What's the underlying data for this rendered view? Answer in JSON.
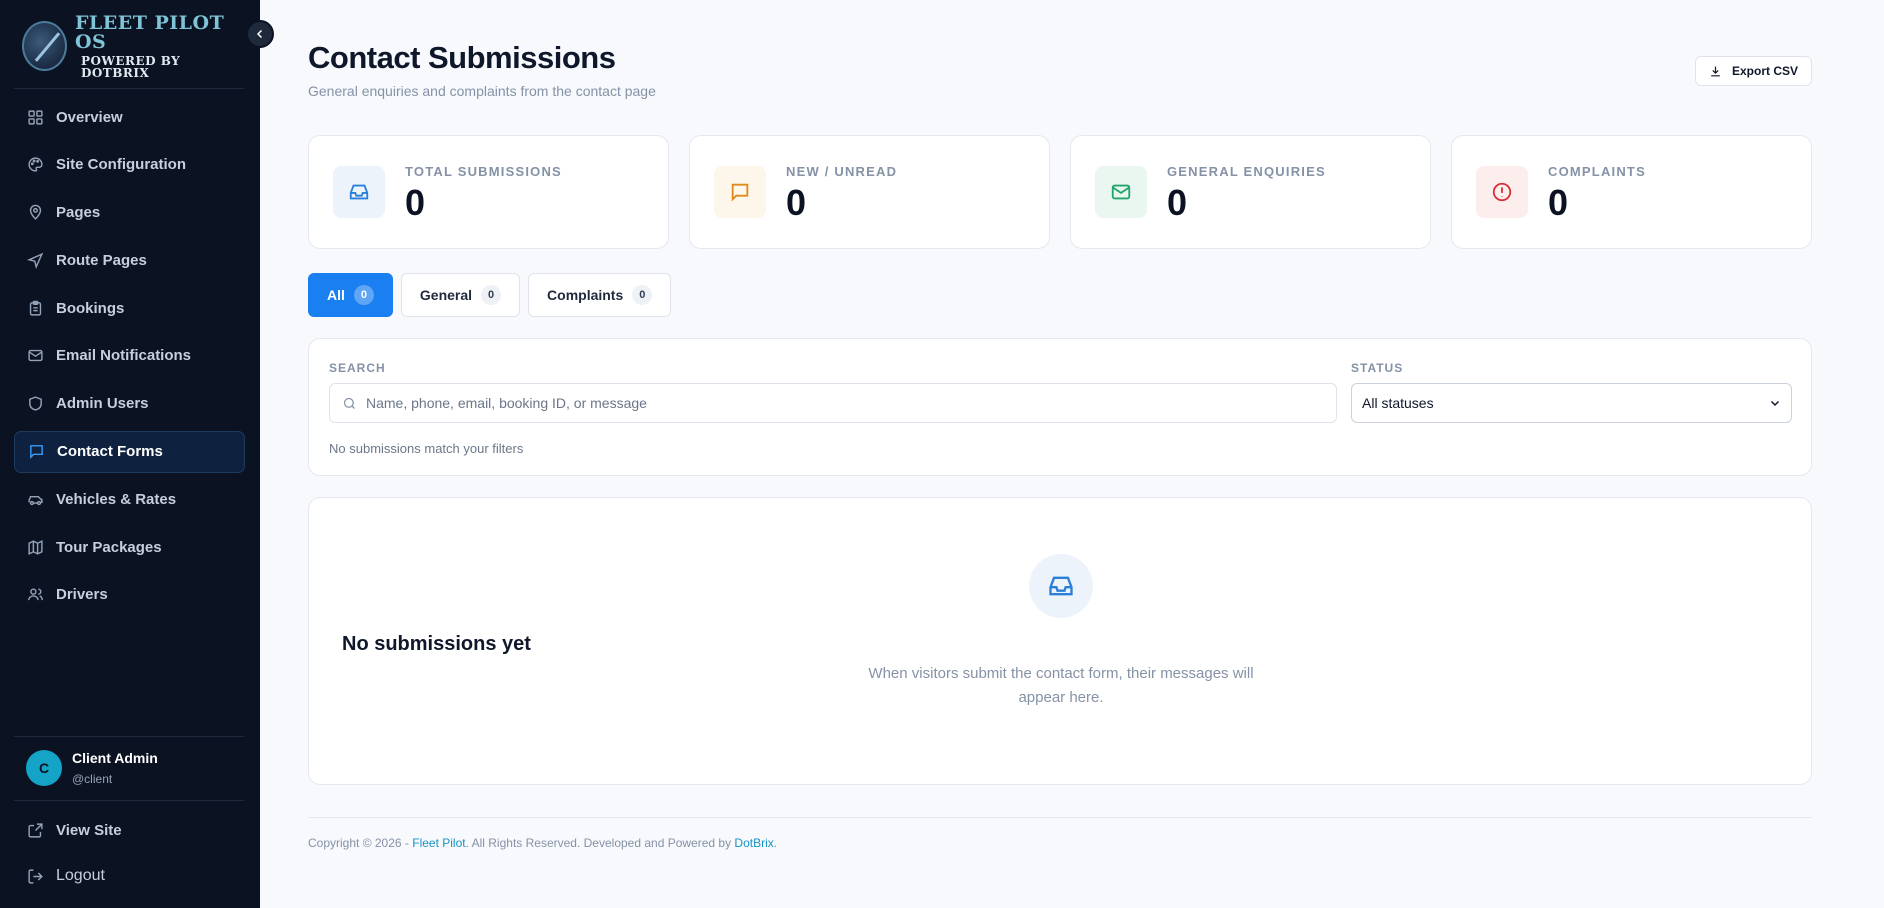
{
  "brand": {
    "title": "FLEET PILOT OS",
    "subtitle": "POWERED BY DOTBRIX"
  },
  "sidebar": {
    "items": [
      {
        "label": "Overview",
        "icon": "grid-icon"
      },
      {
        "label": "Site Configuration",
        "icon": "palette-icon"
      },
      {
        "label": "Pages",
        "icon": "map-pin-icon"
      },
      {
        "label": "Route Pages",
        "icon": "navigation-icon"
      },
      {
        "label": "Bookings",
        "icon": "clipboard-icon"
      },
      {
        "label": "Email Notifications",
        "icon": "mail-icon"
      },
      {
        "label": "Admin Users",
        "icon": "shield-icon"
      },
      {
        "label": "Contact Forms",
        "icon": "message-square-icon",
        "active": true
      },
      {
        "label": "Vehicles & Rates",
        "icon": "car-icon"
      },
      {
        "label": "Tour Packages",
        "icon": "map-icon"
      },
      {
        "label": "Drivers",
        "icon": "users-icon"
      }
    ],
    "user": {
      "initial": "C",
      "name": "Client Admin",
      "handle": "@client"
    },
    "footer": {
      "view_site": "View Site",
      "logout": "Logout"
    }
  },
  "header": {
    "title": "Contact Submissions",
    "subtitle": "General enquiries and complaints from the contact page",
    "export_label": "Export CSV"
  },
  "stats": [
    {
      "label": "TOTAL SUBMISSIONS",
      "value": "0",
      "icon": "inbox-icon",
      "color": "#2b7fd9",
      "bg": "#edf3fb"
    },
    {
      "label": "NEW / UNREAD",
      "value": "0",
      "icon": "message-square-icon",
      "color": "#e08a1e",
      "bg": "#fdf6ea"
    },
    {
      "label": "GENERAL ENQUIRIES",
      "value": "0",
      "icon": "mail-icon",
      "color": "#22a46a",
      "bg": "#e9f7f0"
    },
    {
      "label": "COMPLAINTS",
      "value": "0",
      "icon": "alert-circle-icon",
      "color": "#d9313d",
      "bg": "#fdeeee"
    }
  ],
  "tabs": [
    {
      "label": "All",
      "count": "0",
      "active": true
    },
    {
      "label": "General",
      "count": "0"
    },
    {
      "label": "Complaints",
      "count": "0"
    }
  ],
  "filters": {
    "search_label": "SEARCH",
    "search_placeholder": "Name, phone, email, booking ID, or message",
    "search_value": "",
    "status_label": "STATUS",
    "status_value": "All statuses",
    "no_match": "No submissions match your filters"
  },
  "empty": {
    "title": "No submissions yet",
    "description": "When visitors submit the contact form, their messages will appear here."
  },
  "footer": {
    "prefix": "Copyright © 2026 - ",
    "brand_link": "Fleet Pilot",
    "middle": ". All Rights Reserved. Developed and Powered by ",
    "dev_link": "DotBrix",
    "suffix": "."
  },
  "colors": {
    "accent": "#1a7ff0",
    "sidebar_bg": "#0b1222",
    "link": "#1593c4"
  }
}
